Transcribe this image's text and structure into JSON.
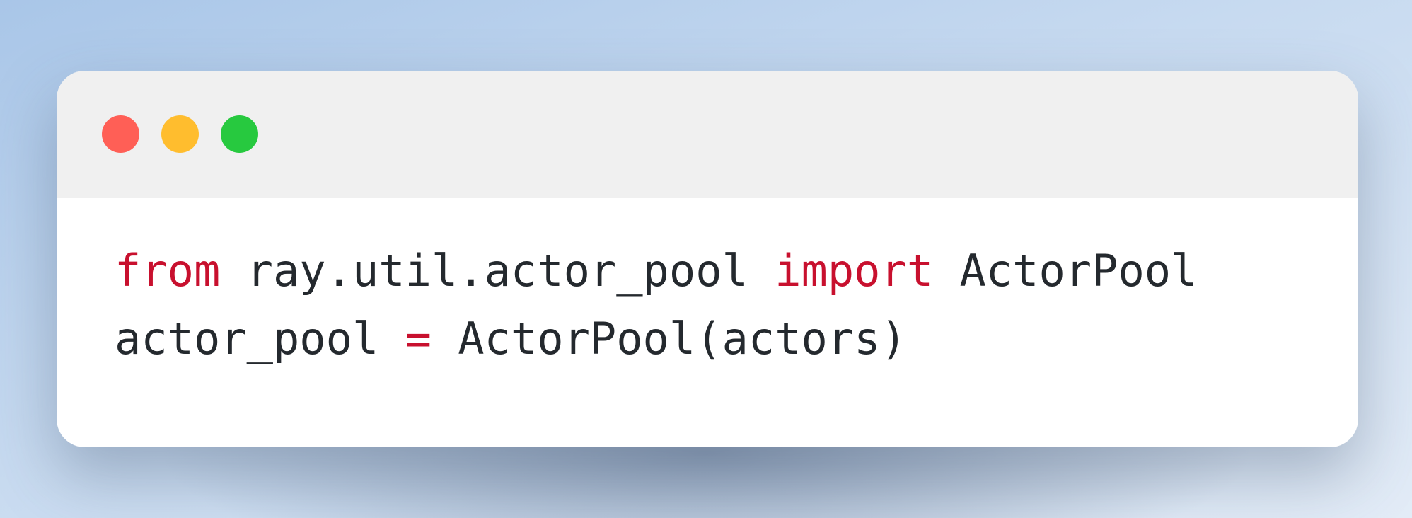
{
  "window": {
    "controls": [
      {
        "name": "close",
        "color": "#ff5f56"
      },
      {
        "name": "minimize",
        "color": "#ffbd2e"
      },
      {
        "name": "zoom",
        "color": "#27c93f"
      }
    ]
  },
  "colors": {
    "keyword": "#c8102e",
    "text": "#24292e",
    "titlebar": "#f0f0f0",
    "editor": "#ffffff"
  },
  "code": {
    "lines": [
      {
        "tokens": [
          {
            "text": "from",
            "kind": "keyword"
          },
          {
            "text": " ray.util.actor_pool ",
            "kind": "plain"
          },
          {
            "text": "import",
            "kind": "keyword"
          },
          {
            "text": " ActorPool",
            "kind": "plain"
          }
        ]
      },
      {
        "tokens": [
          {
            "text": "actor_pool ",
            "kind": "plain"
          },
          {
            "text": "=",
            "kind": "keyword"
          },
          {
            "text": " ActorPool(actors)",
            "kind": "plain"
          }
        ]
      }
    ]
  }
}
